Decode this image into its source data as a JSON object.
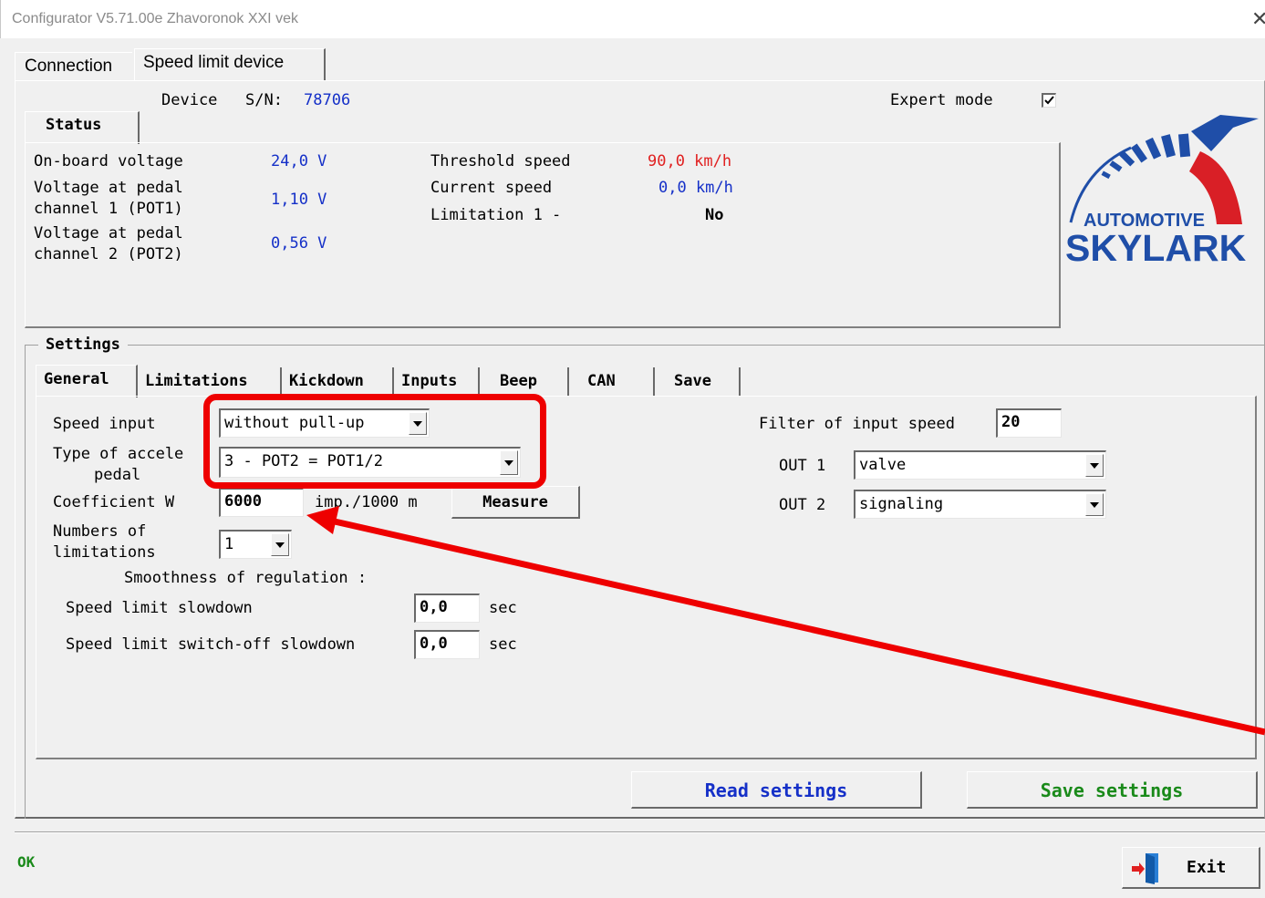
{
  "window": {
    "title": "Configurator V5.71.00e  Zhavoronok XXI vek",
    "close_glyph": "✕"
  },
  "main_tabs": [
    {
      "label": "Connection"
    },
    {
      "label": "Speed limit device"
    }
  ],
  "device": {
    "label": "Device",
    "sn_label": "S/N:",
    "sn_value": "78706",
    "expert_mode_label": "Expert mode",
    "expert_mode_checked": true
  },
  "status": {
    "tab_label": "Status",
    "onboard_voltage_label": "On-board voltage",
    "onboard_voltage_value": "24,0 V",
    "pot1_label_1": "Voltage at pedal",
    "pot1_label_2": "channel 1 (POT1)",
    "pot1_value": "1,10 V",
    "pot2_label_1": "Voltage at pedal",
    "pot2_label_2": "channel 2 (POT2)",
    "pot2_value": "0,56 V",
    "threshold_speed_label": "Threshold speed",
    "threshold_speed_value": "90,0 km/h",
    "current_speed_label": "Current speed",
    "current_speed_value": "0,0 km/h",
    "limitation_label": "Limitation 1 -",
    "limitation_value": "No"
  },
  "logo": {
    "line1": "AUTOMOTIVE",
    "line2": "SKYLARK"
  },
  "settings": {
    "group_label": "Settings",
    "tabs": [
      {
        "label": "General"
      },
      {
        "label": "Limitations"
      },
      {
        "label": "Kickdown"
      },
      {
        "label": "Inputs"
      },
      {
        "label": "Beep"
      },
      {
        "label": "CAN"
      },
      {
        "label": "Save"
      }
    ],
    "general": {
      "speed_input_label": "Speed input",
      "speed_input_value": "without pull-up",
      "accel_type_label_1": "Type of accele",
      "accel_type_label_2": "pedal",
      "accel_type_value": "3 - POT2 = POT1/2",
      "coefficient_label": "Coefficient W",
      "coefficient_value": "6000",
      "coefficient_unit": "imp./1000 m",
      "measure_button": "Measure",
      "num_limitations_label_1": "Numbers of",
      "num_limitations_label_2": "limitations",
      "num_limitations_value": "1",
      "smoothness_label": "Smoothness of regulation :",
      "slowdown_label": "Speed limit slowdown",
      "slowdown_value": "0,0",
      "slowdown_unit": "sec",
      "switchoff_label": "Speed limit switch-off slowdown",
      "switchoff_value": "0,0",
      "switchoff_unit": "sec",
      "filter_label": "Filter of input speed",
      "filter_value": "20",
      "out1_label": "OUT 1",
      "out1_value": "valve",
      "out2_label": "OUT 2",
      "out2_value": "signaling"
    }
  },
  "buttons": {
    "read_settings": "Read settings",
    "save_settings": "Save settings",
    "exit": "Exit"
  },
  "statusbar": {
    "text": "OK"
  },
  "colors": {
    "value_blue": "#1530c8",
    "threshold_red": "#e02020",
    "save_green": "#1a8a1a",
    "annotation_red": "#ee0000",
    "logo_blue": "#1f4ea8",
    "logo_red": "#d91f26"
  }
}
